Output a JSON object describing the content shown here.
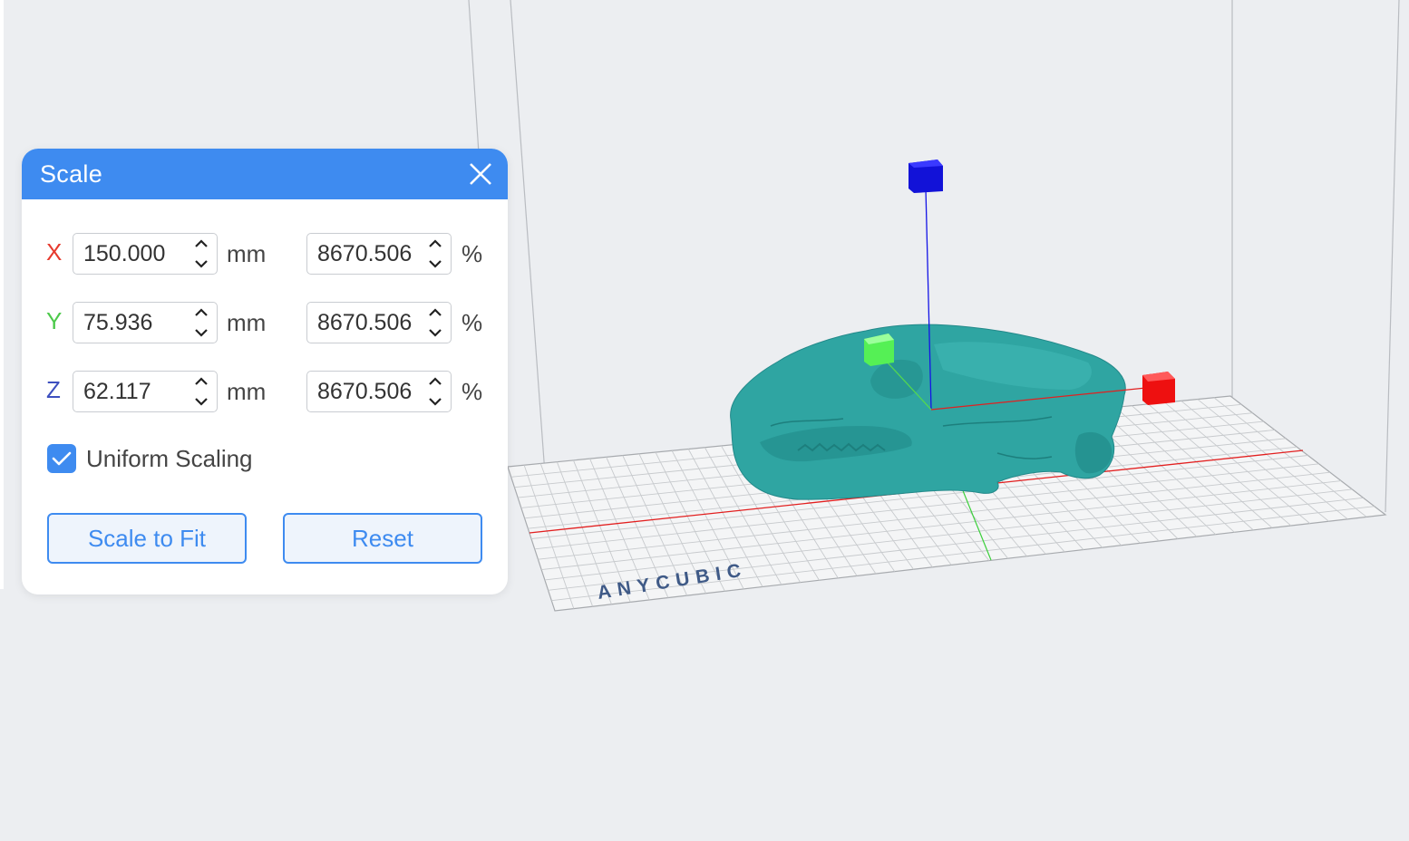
{
  "dialog": {
    "title": "Scale",
    "rows": [
      {
        "axis": "X",
        "mm": "150.000",
        "unit_mm": "mm",
        "percent": "8670.506",
        "unit_pct": "%"
      },
      {
        "axis": "Y",
        "mm": "75.936",
        "unit_mm": "mm",
        "percent": "8670.506",
        "unit_pct": "%"
      },
      {
        "axis": "Z",
        "mm": "62.117",
        "unit_mm": "mm",
        "percent": "8670.506",
        "unit_pct": "%"
      }
    ],
    "uniform_scaling": {
      "label": "Uniform Scaling",
      "checked": true
    },
    "buttons": {
      "scale_to_fit": "Scale to Fit",
      "reset": "Reset"
    }
  },
  "viewport": {
    "bed_logo": "ANYCUBIC",
    "model_color": "#2fa5a2",
    "gizmo_colors": {
      "x": "#ff1a1a",
      "y": "#66ff66",
      "z": "#1414e6"
    }
  },
  "colors": {
    "accent": "#3e8bf0",
    "axis_x": "#e63a2e",
    "axis_y": "#4cc94a",
    "axis_z": "#3d4fbf"
  }
}
